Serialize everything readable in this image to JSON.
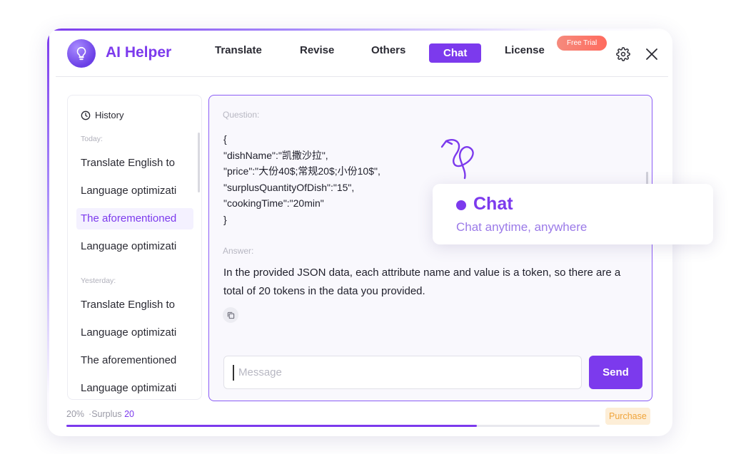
{
  "app": {
    "title": "AI Helper"
  },
  "nav": {
    "translate": "Translate",
    "revise": "Revise",
    "others": "Others",
    "chat": "Chat",
    "license": "License",
    "free_trial": "Free Trial",
    "active": "Chat"
  },
  "sidebar": {
    "history_label": "History",
    "groups": [
      {
        "label": "Today:",
        "items": [
          "Translate English to",
          "Language optimizati",
          "The aforementioned",
          "Language optimizati"
        ]
      },
      {
        "label": "Yesterday:",
        "items": [
          "Translate English to",
          "Language optimizati",
          "The aforementioned",
          "Language optimizati"
        ]
      }
    ],
    "selected": "The aforementioned"
  },
  "chat": {
    "question_label": "Question:",
    "question_text": "{\n\"dishName\":\"凯撒沙拉\",\n\"price\":\"大份40$;常规20$;小份10$\",\n\"surplusQuantityOfDish\":\"15\",\n\"cookingTime\":\"20min\"\n}",
    "answer_label": "Answer:",
    "answer_text": "In the provided JSON data, each attribute name and value is a token, so there are a total of 20 tokens in the data you provided.",
    "input_placeholder": "Message",
    "send_label": "Send"
  },
  "footer": {
    "percent": "20%",
    "surplus_label": "·Surplus",
    "surplus_value": "20",
    "progress_fraction": 0.77,
    "purchase_label": "Purchase"
  },
  "feature_card": {
    "title": "Chat",
    "subtitle": "Chat anytime, anywhere"
  },
  "colors": {
    "accent": "#7c3aed",
    "trial": "#ff6b5e",
    "purchase_bg": "#fdeed7",
    "purchase_text": "#f0a43a"
  }
}
